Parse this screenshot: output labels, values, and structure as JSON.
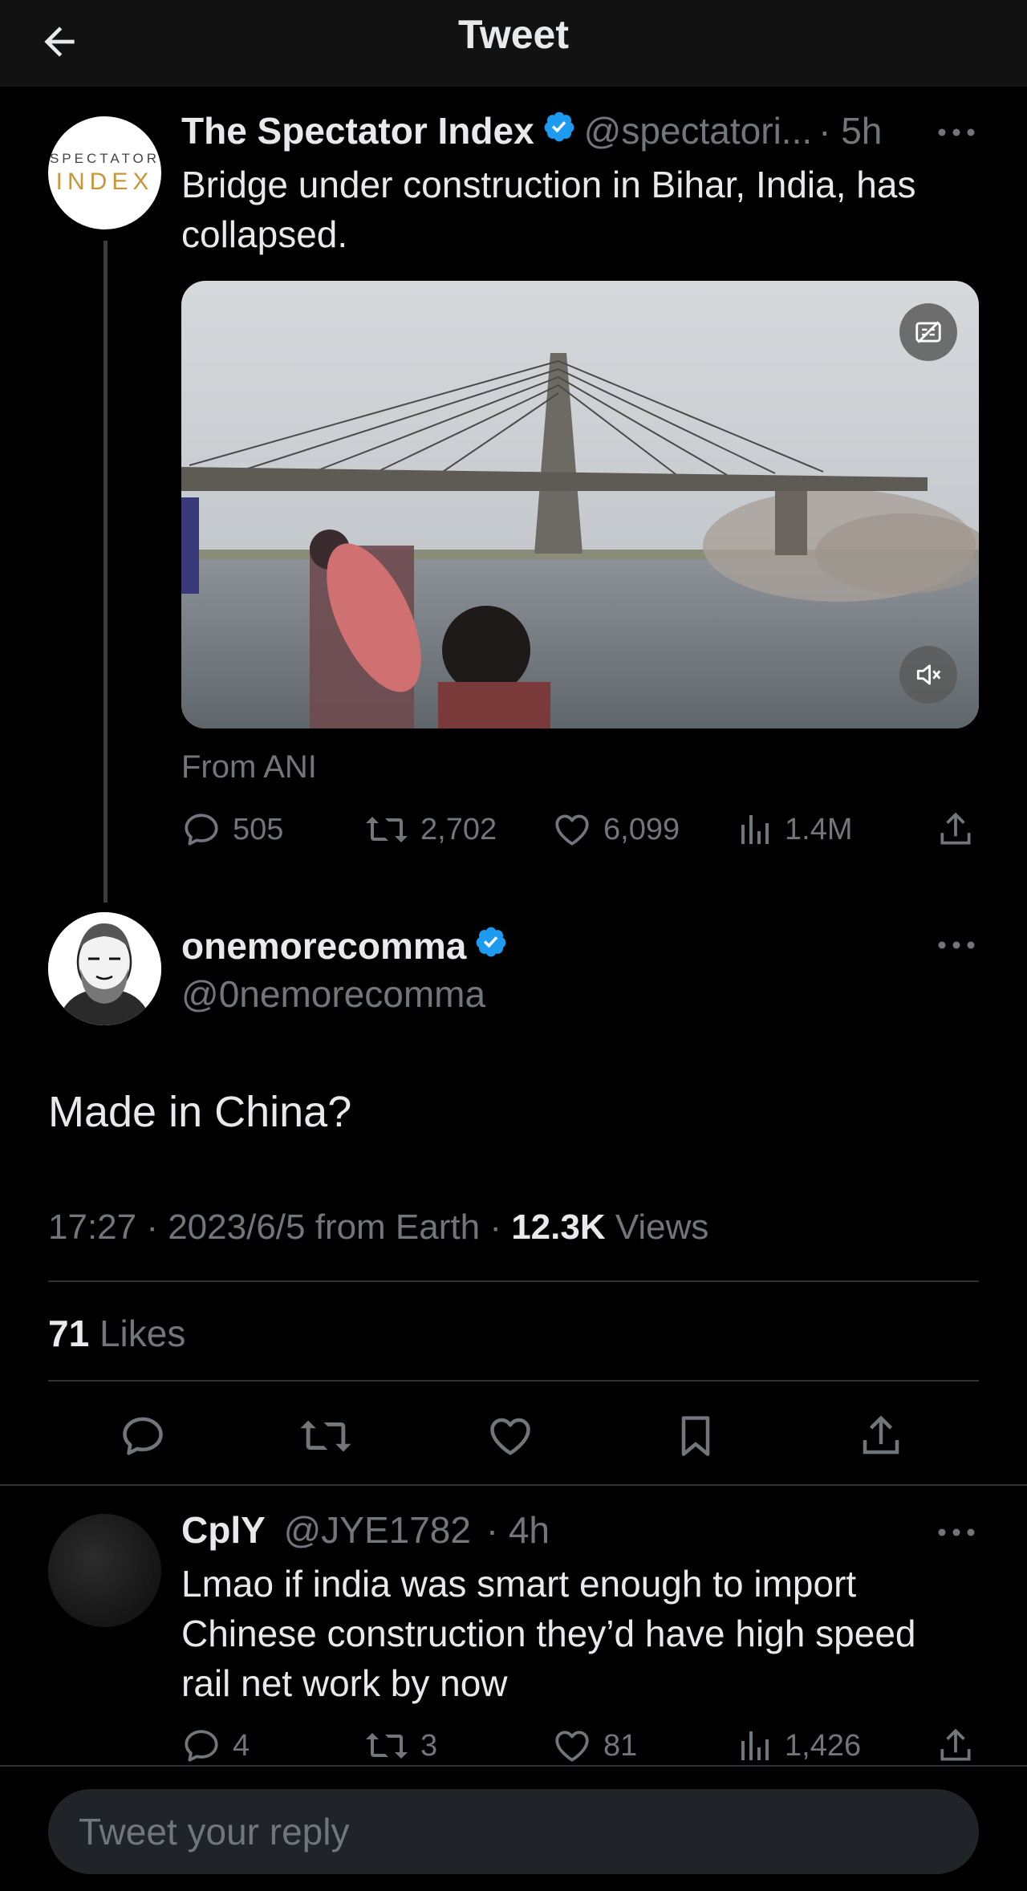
{
  "header": {
    "title": "Tweet",
    "back_icon": "arrow-left-icon"
  },
  "quoted_tweet": {
    "avatar": {
      "line1": "SPECTATOR",
      "line2": "INDEX"
    },
    "name": "The Spectator Index",
    "handle": "@spectatori...",
    "time": "· 5h",
    "text_line1": "Bridge under construction in Bihar, India, has",
    "text_line2": "collapsed.",
    "media": {
      "type": "video",
      "caption_icon": "captions-off-icon",
      "mute_icon": "muted-speaker-icon"
    },
    "source": "From ANI",
    "stats": {
      "replies": "505",
      "retweets": "2,702",
      "likes": "6,099",
      "views": "1.4M"
    }
  },
  "focused_tweet": {
    "name": "onemorecomma",
    "handle": "@0nemorecomma",
    "text": "Made in China?",
    "meta_time": "17:27 · 2023/6/5 from Earth · ",
    "meta_views_count": "12.3K",
    "meta_views_label": " Views",
    "likes_count": "71",
    "likes_label": " Likes"
  },
  "comment": {
    "name": "CplY",
    "handle": "@JYE1782",
    "time": "· 4h",
    "text_line1": "Lmao if india was smart enough to import",
    "text_line2": "Chinese construction they’d have high speed",
    "text_line3": "rail net work by now",
    "stats": {
      "replies": "4",
      "retweets": "3",
      "likes": "81",
      "views": "1,426"
    }
  },
  "reply_bar": {
    "placeholder": "Tweet your reply"
  },
  "colors": {
    "background": "#000000",
    "text": "#e7e9ea",
    "muted": "#71767b",
    "verified": "#1d9bf0",
    "divider": "#2f3336"
  }
}
